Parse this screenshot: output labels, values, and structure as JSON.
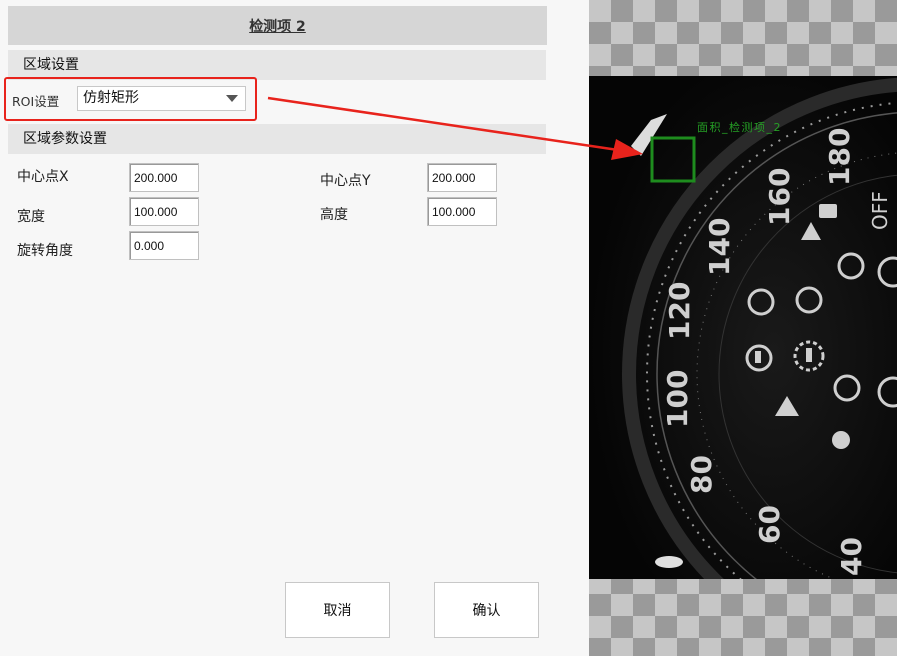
{
  "dialog": {
    "title": "检测项 2"
  },
  "region_section": {
    "title": "区域设置",
    "roi_label": "ROI设置",
    "roi_shape_selected": "仿射矩形"
  },
  "params_section": {
    "title": "区域参数设置",
    "center_x": {
      "label": "中心点X",
      "value": "200.000"
    },
    "center_y": {
      "label": "中心点Y",
      "value": "200.000"
    },
    "width": {
      "label": "宽度",
      "value": "100.000"
    },
    "height": {
      "label": "高度",
      "value": "100.000"
    },
    "rotation": {
      "label": "旋转角度",
      "value": "0.000"
    }
  },
  "buttons": {
    "cancel": "取消",
    "confirm": "确认"
  },
  "preview": {
    "roi_overlay_label": "面积_检测项_2",
    "dial_numbers": [
      "180",
      "160",
      "140",
      "120",
      "100",
      "80",
      "60",
      "40"
    ],
    "off_text": "OFF",
    "roi_color": "#1e8c1e",
    "annotation_color": "#e8231c"
  }
}
